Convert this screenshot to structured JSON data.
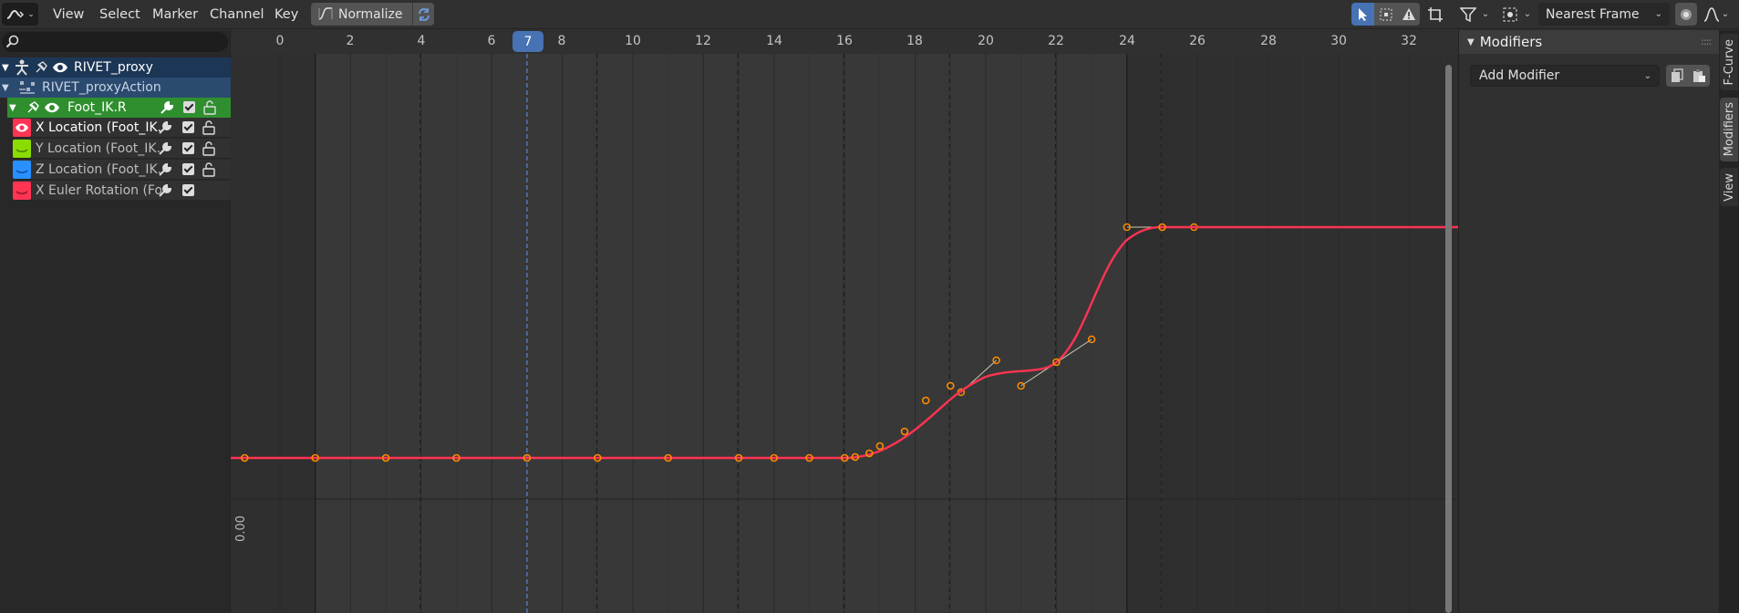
{
  "header": {
    "menus": [
      "View",
      "Select",
      "Marker",
      "Channel",
      "Key"
    ],
    "normalize_label": "Normalize",
    "snapping_mode": "Nearest Frame"
  },
  "channels": {
    "search_placeholder": "",
    "object": "RIVET_proxy",
    "action": "RIVET_proxyAction",
    "group": "Foot_IK.R",
    "fcurves": [
      {
        "label": "X Location (Foot_IK.R",
        "color": "#ff3352",
        "highlighted": true
      },
      {
        "label": "Y Location (Foot_IK.R",
        "color": "#8bdc00",
        "highlighted": false
      },
      {
        "label": "Z Location (Foot_IK.R",
        "color": "#2890ff",
        "highlighted": false
      },
      {
        "label": "X Euler Rotation (Foot_IK.R",
        "color": "#ff3352",
        "highlighted": false
      }
    ]
  },
  "graph": {
    "frame_ticks": [
      "0",
      "2",
      "4",
      "6",
      "8",
      "10",
      "12",
      "14",
      "16",
      "18",
      "20",
      "22",
      "24",
      "26",
      "28",
      "30",
      "32"
    ],
    "current_frame": "7",
    "y_axis_value": "0.00",
    "curve_color": "#ff3352",
    "keyframe_color": "#ff8c00",
    "keyframes_frames": [
      0.5,
      2,
      4,
      6,
      8,
      10,
      12,
      14,
      15,
      16,
      16.4,
      16.7,
      17,
      18,
      19,
      20,
      21,
      22,
      23,
      24,
      25
    ]
  },
  "sidebar": {
    "panel_title": "Modifiers",
    "add_modifier_label": "Add Modifier",
    "tabs": [
      "F-Curve",
      "Modifiers",
      "View"
    ],
    "active_tab": "Modifiers"
  }
}
